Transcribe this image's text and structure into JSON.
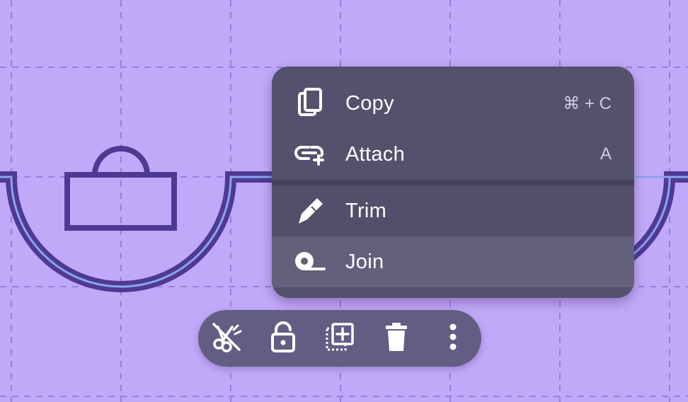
{
  "canvas": {
    "background": "#c1a9f9",
    "shape_stroke": "#4f3a93",
    "highlight_line": "#8aa4ee"
  },
  "context_menu": {
    "background": "#54516d",
    "items": [
      {
        "label": "Copy",
        "shortcut": "⌘ + C",
        "icon": "copy-icon"
      },
      {
        "label": "Attach",
        "shortcut": "A",
        "icon": "attach-link-icon"
      },
      {
        "label": "Trim",
        "shortcut": "",
        "icon": "pen-nib-icon"
      },
      {
        "label": "Join",
        "shortcut": "",
        "icon": "tape-icon"
      }
    ],
    "hovered_item": "Join"
  },
  "toolbar": {
    "background": "#635d84",
    "buttons": [
      {
        "icon": "cut-icon"
      },
      {
        "icon": "unlock-icon"
      },
      {
        "icon": "duplicate-icon"
      },
      {
        "icon": "delete-icon"
      },
      {
        "icon": "more-vert-icon"
      }
    ]
  }
}
